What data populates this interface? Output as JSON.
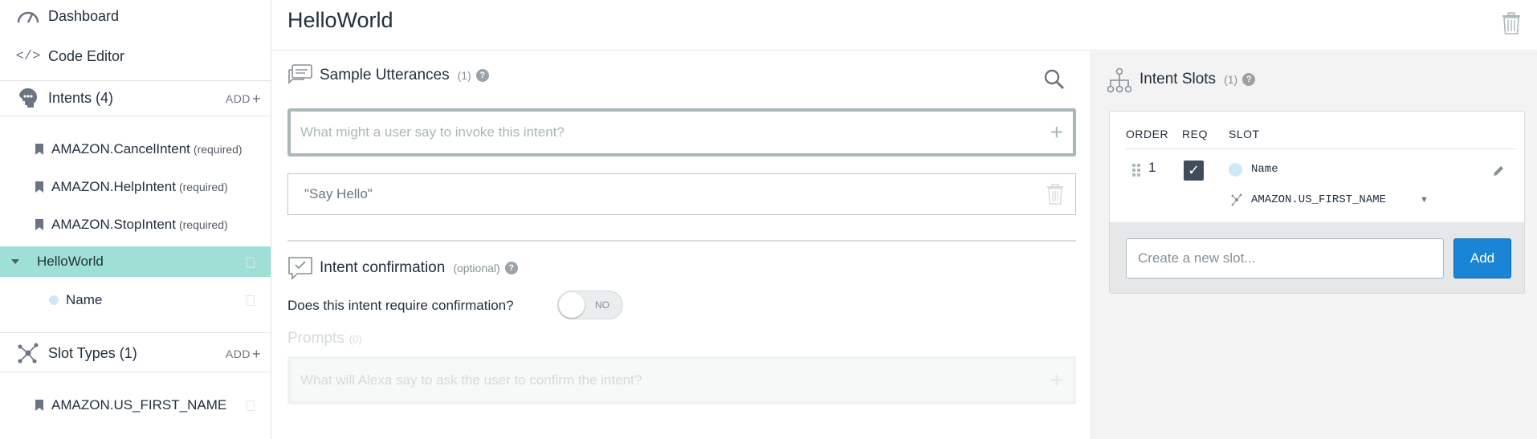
{
  "sidebar": {
    "dashboard_label": "Dashboard",
    "code_editor_label": "Code Editor",
    "intents_label": "Intents (4)",
    "intents_add": "ADD",
    "intents": [
      {
        "label": "AMAZON.CancelIntent",
        "note": "(required)"
      },
      {
        "label": "AMAZON.HelpIntent",
        "note": "(required)"
      },
      {
        "label": "AMAZON.StopIntent",
        "note": "(required)"
      }
    ],
    "active_intent": "HelloWorld",
    "active_slot": "Name",
    "slot_types_label": "Slot Types (1)",
    "slot_types_add": "ADD",
    "slot_types": [
      {
        "label": "AMAZON.US_FIRST_NAME"
      }
    ]
  },
  "header": {
    "title": "HelloWorld"
  },
  "utterances": {
    "title": "Sample Utterances",
    "count": "(1)",
    "placeholder": "What might a user say to invoke this intent?",
    "items": [
      "\"Say Hello\""
    ]
  },
  "confirmation": {
    "title": "Intent confirmation",
    "optional": "(optional)",
    "question": "Does this intent require confirmation?",
    "toggle_label": "NO",
    "prompts_title": "Prompts",
    "prompts_count": "(0)",
    "prompt_placeholder": "What will Alexa say to ask the user to confirm the intent?"
  },
  "slots": {
    "title": "Intent Slots",
    "count": "(1)",
    "headers": {
      "order": "ORDER",
      "req": "REQ",
      "slot": "SLOT"
    },
    "rows": [
      {
        "order": "1",
        "name": "Name",
        "type": "AMAZON.US_FIRST_NAME",
        "required": true
      }
    ],
    "new_placeholder": "Create a new slot...",
    "add_label": "Add"
  },
  "colors": {
    "accent": "#1a85d6",
    "active_row": "#9fe0d6",
    "slot_dot": "#cfe8f8"
  }
}
